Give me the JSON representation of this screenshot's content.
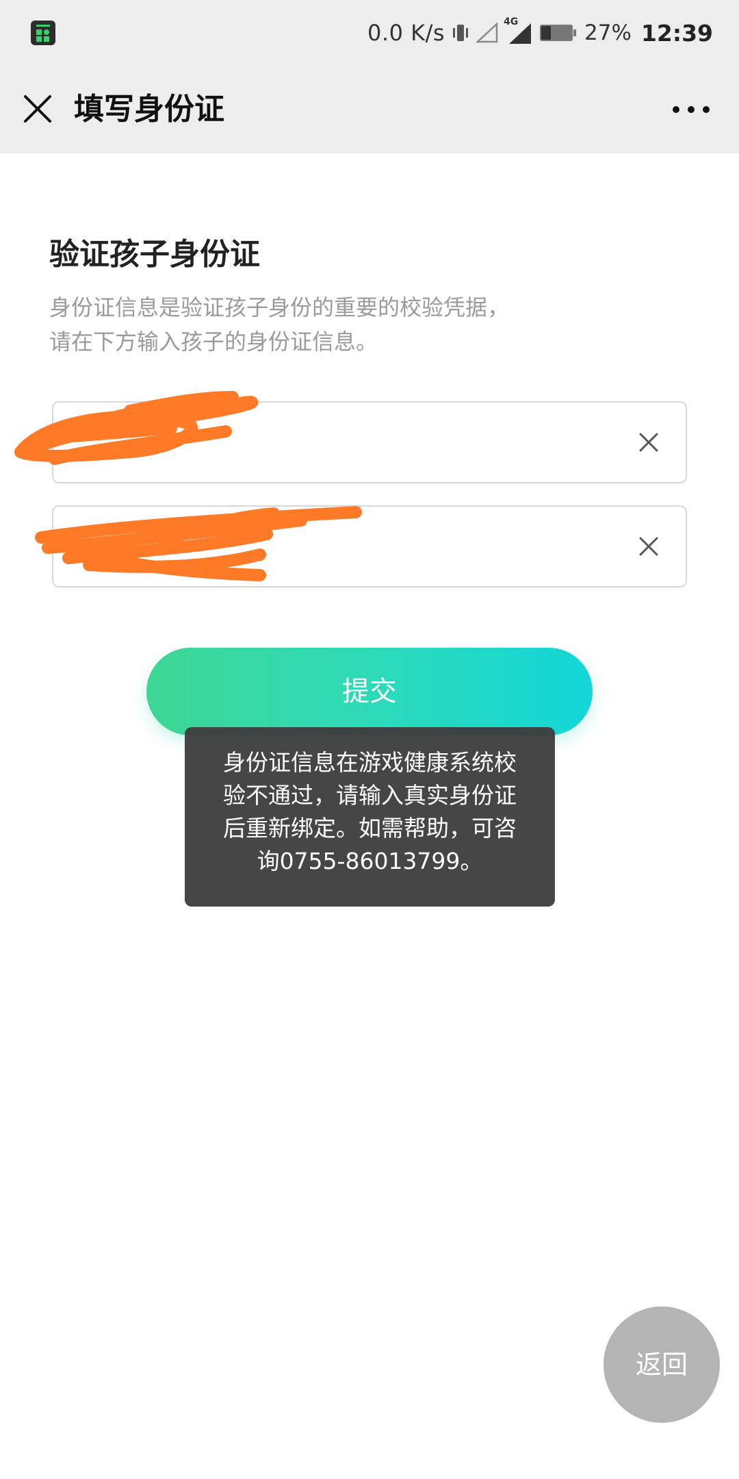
{
  "status_bar": {
    "net_speed": "0.0 K/s",
    "network_type": "4G",
    "battery_percent": "27%",
    "time": "12:39",
    "icons": [
      "app-icon",
      "vibrate-icon",
      "signal-empty-icon",
      "signal-4g-icon",
      "battery-icon"
    ]
  },
  "nav": {
    "title": "填写身份证",
    "close_icon": "close-icon",
    "more_icon": "more-dots-icon"
  },
  "content": {
    "title": "验证孩子身份证",
    "description_lines": [
      "身份证信息是验证孩子身份的重要的校验凭据，",
      "请在下方输入孩子的身份证信息。"
    ]
  },
  "inputs": [
    {
      "value": "",
      "clear_icon": "clear-icon"
    },
    {
      "value": "",
      "clear_icon": "clear-icon"
    }
  ],
  "submit": {
    "label": "提交"
  },
  "toast": {
    "lines": [
      "身份证信息在游戏健康系统校",
      "验不通过，请输入真实身份证",
      "后重新绑定。如需帮助，可咨",
      "询0755-86013799。"
    ]
  },
  "back_button": {
    "label": "返回"
  },
  "colors": {
    "status_bar_bg": "#ededed",
    "accent_start": "#3ed694",
    "accent_end": "#12d6d8",
    "toast_bg": "#3c3c3c",
    "redaction": "#ff7a26",
    "back_button_bg": "#b4b4b4"
  }
}
